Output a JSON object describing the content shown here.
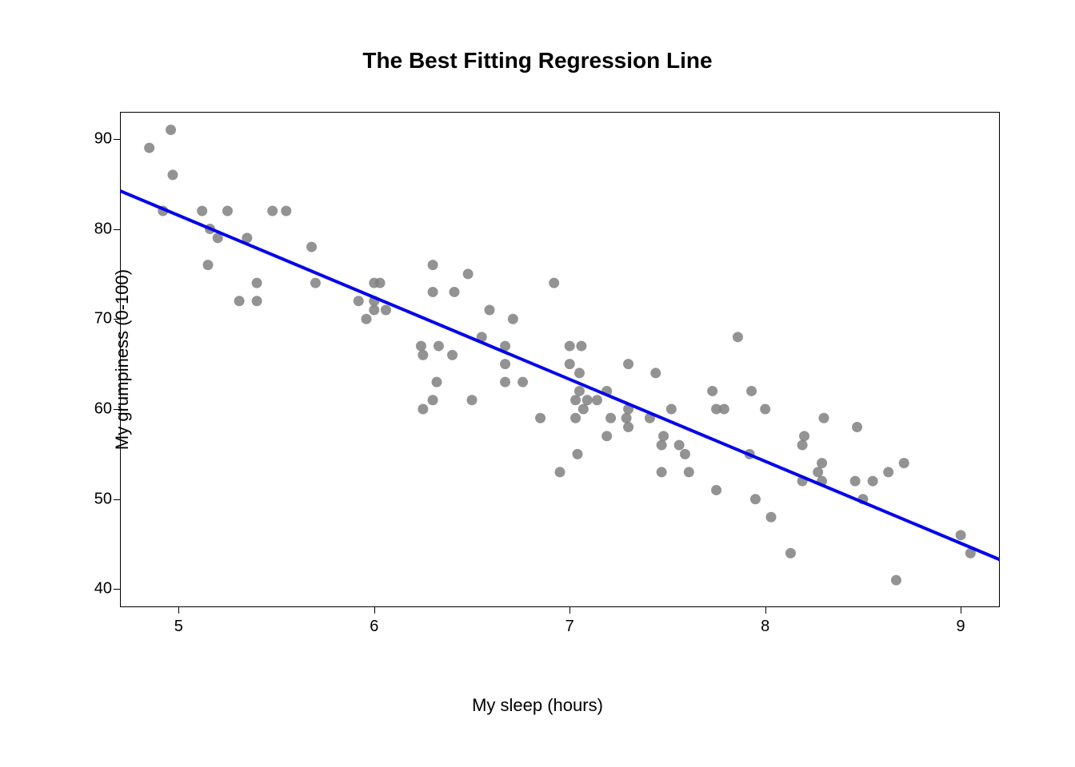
{
  "chart_data": {
    "type": "scatter",
    "title": "The Best Fitting Regression Line",
    "xlabel": "My sleep (hours)",
    "ylabel": "My grumpiness (0-100)",
    "xlim": [
      4.7,
      9.2
    ],
    "ylim": [
      38,
      93
    ],
    "x_ticks": [
      5,
      6,
      7,
      8,
      9
    ],
    "y_ticks": [
      40,
      50,
      60,
      70,
      80,
      90
    ],
    "series": [
      {
        "name": "observations",
        "type": "points",
        "x": [
          4.85,
          4.96,
          4.97,
          4.92,
          5.16,
          5.12,
          5.25,
          5.15,
          5.2,
          5.35,
          5.31,
          5.48,
          5.55,
          5.4,
          5.4,
          5.68,
          5.7,
          6.0,
          5.92,
          5.96,
          6.0,
          6.0,
          6.03,
          6.06,
          6.24,
          6.25,
          6.3,
          6.3,
          6.25,
          6.33,
          6.3,
          6.32,
          6.4,
          6.41,
          6.48,
          6.5,
          6.59,
          6.67,
          6.55,
          6.67,
          6.67,
          6.71,
          6.76,
          6.85,
          6.92,
          7.0,
          6.95,
          7.0,
          7.04,
          7.05,
          7.05,
          7.03,
          7.03,
          7.06,
          7.07,
          7.09,
          7.14,
          7.19,
          7.19,
          7.21,
          7.3,
          7.3,
          7.29,
          7.3,
          7.41,
          7.44,
          7.48,
          7.47,
          7.47,
          7.52,
          7.56,
          7.59,
          7.61,
          7.73,
          7.75,
          7.75,
          7.79,
          7.86,
          7.92,
          7.93,
          7.95,
          8.0,
          8.03,
          8.13,
          8.19,
          8.2,
          8.19,
          8.27,
          8.3,
          8.29,
          8.29,
          8.46,
          8.47,
          8.5,
          8.55,
          8.63,
          8.67,
          8.71,
          9.0,
          9.05
        ],
        "y": [
          89,
          91,
          86,
          82,
          80,
          82,
          82,
          76,
          79,
          79,
          72,
          82,
          82,
          74,
          72,
          78,
          74,
          74,
          72,
          70,
          71,
          72,
          74,
          71,
          67,
          66,
          73,
          76,
          60,
          67,
          61,
          63,
          66,
          73,
          75,
          61,
          71,
          65,
          68,
          67,
          63,
          70,
          63,
          59,
          74,
          65,
          53,
          67,
          55,
          64,
          62,
          61,
          59,
          67,
          60,
          61,
          61,
          62,
          57,
          59,
          58,
          60,
          59,
          65,
          59,
          64,
          57,
          56,
          53,
          60,
          56,
          55,
          53,
          62,
          60,
          51,
          60,
          68,
          55,
          62,
          50,
          60,
          48,
          44,
          52,
          57,
          56,
          53,
          59,
          54,
          52,
          52,
          58,
          50,
          52,
          53,
          41,
          54,
          46,
          44
        ]
      }
    ],
    "regression_line": {
      "intercept": 127.0,
      "slope": -9.1,
      "x_start": 4.7,
      "x_end": 9.2
    },
    "colors": {
      "points": "#808080",
      "line": "#0000EE"
    }
  }
}
